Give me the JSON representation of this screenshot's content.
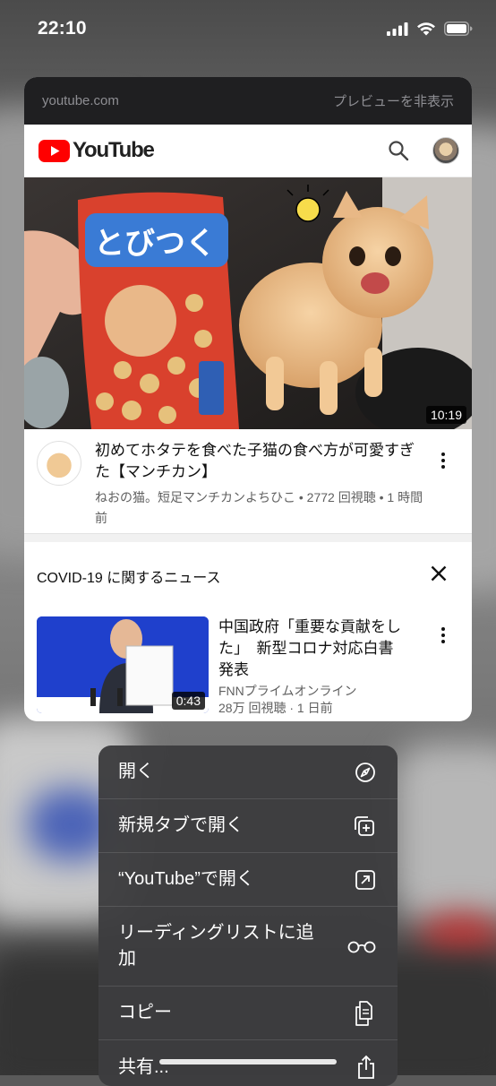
{
  "status_bar": {
    "time": "22:10"
  },
  "preview": {
    "domain": "youtube.com",
    "hide_preview_label": "プレビューを非表示",
    "youtube_wordmark": "YouTube",
    "video": {
      "duration": "10:19",
      "title": "初めてホタテを食べた子猫の食べ方が可愛すぎた【マンチカン】",
      "meta": "ねおの猫。短足マンチカンよちひこ • 2772 回視聴 • 1 時間前"
    },
    "news_section": {
      "heading": "COVID-19 に関するニュース",
      "item": {
        "title": "中国政府「重要な貢献をした」　新型コロナ対応白書発表",
        "channel": "FNNプライムオンライン",
        "stats": "28万 回視聴 · 1 日前",
        "duration": "0:43"
      }
    }
  },
  "menu": {
    "items": [
      {
        "label": "開く",
        "icon": "compass-icon"
      },
      {
        "label": "新規タブで開く",
        "icon": "new-tab-icon"
      },
      {
        "label": "“YouTube”で開く",
        "icon": "open-external-icon"
      },
      {
        "label": "リーディングリストに追加",
        "icon": "glasses-icon"
      },
      {
        "label": "コピー",
        "icon": "copy-icon"
      },
      {
        "label": "共有...",
        "icon": "share-icon"
      }
    ]
  },
  "colors": {
    "youtube_red": "#ff0000",
    "menu_bg": "#3c3c3e",
    "card_header": "#1f1f21"
  }
}
